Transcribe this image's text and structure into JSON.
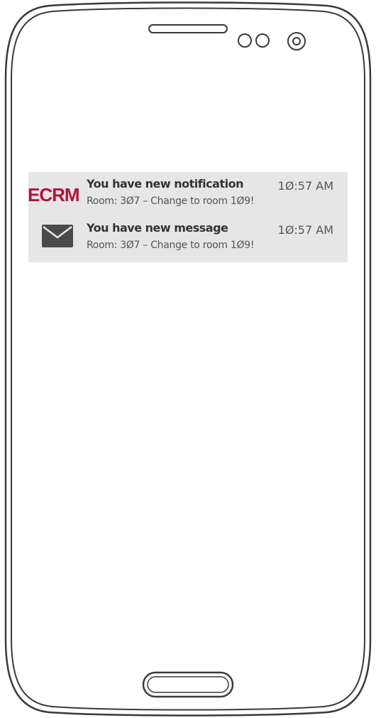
{
  "notifications": [
    {
      "app": "ECRM",
      "title": "You have new notification",
      "body": "Room: 3Ø7 – Change to room 1Ø9!",
      "time": "1Ø:57 AM",
      "icon": "ecrm-logo-icon"
    },
    {
      "title": "You have new message",
      "body": "Room: 3Ø7 – Change to room 1Ø9!",
      "time": "1Ø:57 AM",
      "icon": "envelope-icon"
    }
  ],
  "colors": {
    "logo": "#b4123a",
    "panel": "#e6e6e6",
    "icon": "#4a4a4a",
    "stroke": "#3a3a3a"
  }
}
